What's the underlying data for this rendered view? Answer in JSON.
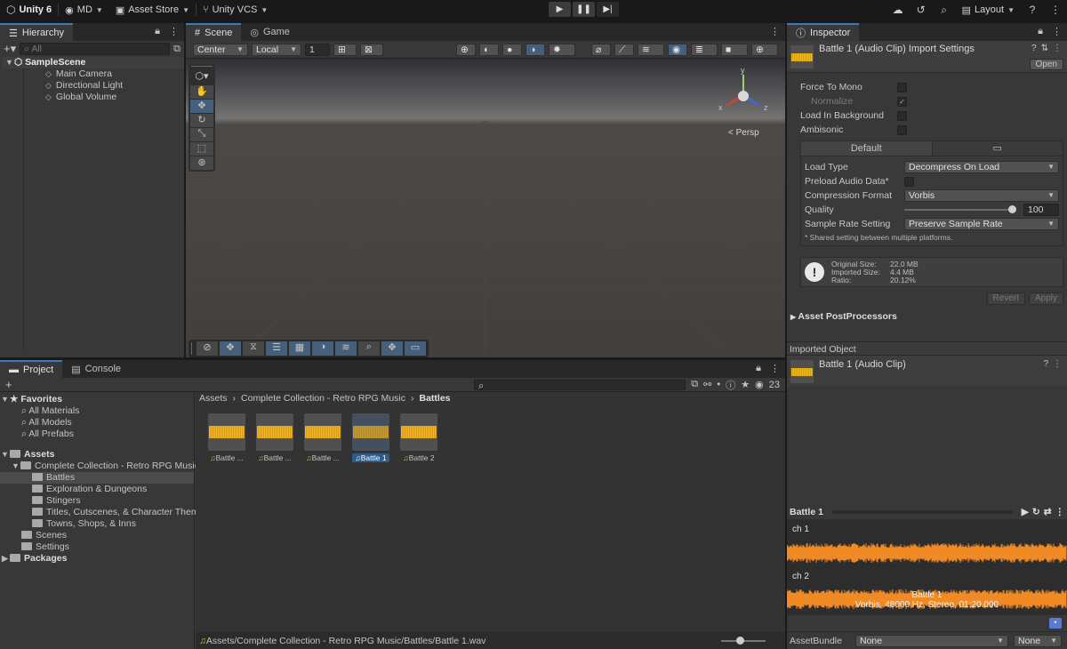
{
  "topbar": {
    "product": "Unity 6",
    "account": "MD",
    "asset_store": "Asset Store",
    "vcs": "Unity VCS",
    "layout": "Layout"
  },
  "hierarchy": {
    "tab": "Hierarchy",
    "search_placeholder": "All",
    "scene": "SampleScene",
    "items": [
      "Main Camera",
      "Directional Light",
      "Global Volume"
    ]
  },
  "scene": {
    "tabs": [
      "Scene",
      "Game"
    ],
    "pivot": "Center",
    "space": "Local",
    "grid_value": "1",
    "persp": "< Persp",
    "gizmo_axes": {
      "x": "x",
      "y": "y",
      "z": "z"
    }
  },
  "project": {
    "tabs": [
      "Project",
      "Console"
    ],
    "badge_count": "23",
    "tree": {
      "favorites": "Favorites",
      "fav_items": [
        "All Materials",
        "All Models",
        "All Prefabs"
      ],
      "assets": "Assets",
      "collection": "Complete Collection - Retro RPG Music",
      "subfolders": [
        "Battles",
        "Exploration & Dungeons",
        "Stingers",
        "Titles, Cutscenes, & Character Theme",
        "Towns, Shops, & Inns"
      ],
      "other": [
        "Scenes",
        "Settings"
      ],
      "packages": "Packages"
    },
    "breadcrumb": [
      "Assets",
      "Complete Collection - Retro RPG Music",
      "Battles"
    ],
    "files": [
      "Battle ...",
      "Battle ...",
      "Battle ...",
      "Battle 1",
      "Battle 2"
    ],
    "status_path": "Assets/Complete Collection - Retro RPG Music/Battles/Battle 1.wav"
  },
  "inspector": {
    "tab": "Inspector",
    "title": "Battle 1 (Audio Clip) Import Settings",
    "open": "Open",
    "toggles": [
      {
        "label": "Force To Mono",
        "checked": false
      },
      {
        "label": "Normalize",
        "checked": true
      },
      {
        "label": "Load In Background",
        "checked": false
      },
      {
        "label": "Ambisonic",
        "checked": false
      }
    ],
    "platform_tab": "Default",
    "settings": {
      "load_type_label": "Load Type",
      "load_type": "Decompress On Load",
      "preload_label": "Preload Audio Data*",
      "compression_label": "Compression Format",
      "compression": "Vorbis",
      "quality_label": "Quality",
      "quality": "100",
      "quality_value": 100,
      "sample_label": "Sample Rate Setting",
      "sample": "Preserve Sample Rate",
      "note": "* Shared setting between multiple platforms."
    },
    "info": {
      "original_label": "Original Size:",
      "original": "22.0 MB",
      "imported_label": "Imported Size:",
      "imported": "4.4 MB",
      "ratio_label": "Ratio:",
      "ratio": "20.12%"
    },
    "revert": "Revert",
    "apply": "Apply",
    "postprocessors": "Asset PostProcessors",
    "imported_object": "Imported Object",
    "clip_name": "Battle 1 (Audio Clip)",
    "preview": {
      "name": "Battle 1",
      "ch1": "ch 1",
      "ch2": "ch 2",
      "overlay_name": "Battle 1",
      "overlay_info": "Vorbis, 48000 Hz, Stereo, 01:20.000"
    },
    "assetbundle_label": "AssetBundle",
    "bundle": "None",
    "variant": "None"
  },
  "colors": {
    "accent": "#3a79bb",
    "waveform": "#f08a24",
    "thumb_wave": "#f1b820"
  }
}
